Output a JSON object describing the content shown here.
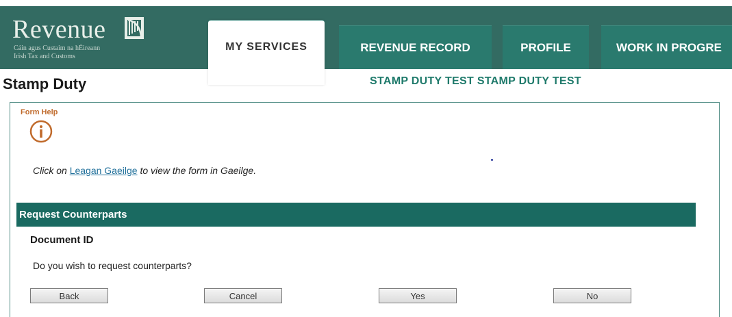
{
  "header": {
    "logo_title": "Revenue",
    "logo_subtitle_line1": "Cáin agus Custaim na hÉireann",
    "logo_subtitle_line2": "Irish Tax and Customs",
    "tabs": [
      {
        "label": "MY SERVICES",
        "active": true
      },
      {
        "label": "REVENUE RECORD",
        "active": false
      },
      {
        "label": "PROFILE",
        "active": false
      },
      {
        "label": "WORK IN PROGRE",
        "active": false
      }
    ]
  },
  "page": {
    "title": "Stamp Duty",
    "test_banner": "STAMP DUTY TEST STAMP DUTY TEST"
  },
  "form_help": {
    "label": "Form Help",
    "icon": "info-icon",
    "text_before": "Click on ",
    "link_text": "Leagan Gaeilge",
    "text_after": " to view the form in Gaeilge."
  },
  "section": {
    "title": "Request Counterparts",
    "field_label": "Document ID",
    "question": "Do you wish to request counterparts?"
  },
  "buttons": {
    "back": "Back",
    "cancel": "Cancel",
    "yes": "Yes",
    "no": "No"
  },
  "colors": {
    "brand_green": "#336b62",
    "tab_green": "#2a7a6e",
    "section_green": "#1a6a61",
    "help_orange": "#c06a2b"
  }
}
